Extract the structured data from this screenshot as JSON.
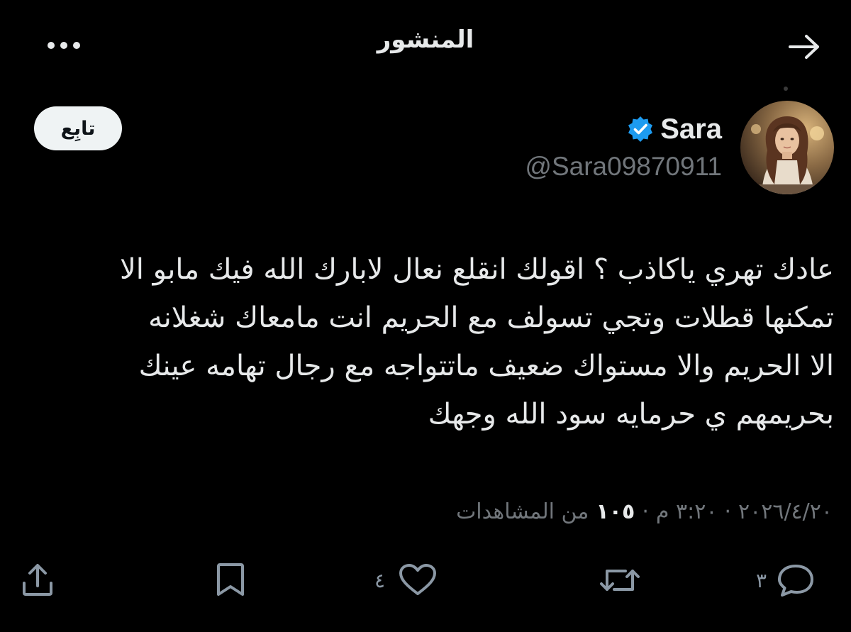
{
  "header": {
    "title": "المنشور",
    "more_icon": "more-dots-icon",
    "back_icon": "arrow-right-icon"
  },
  "author": {
    "display_name": "Sara",
    "handle": "@Sara09870911",
    "verified_icon": "verified-badge-icon",
    "verified_color": "#1d9bf0",
    "follow_label": "تابِع"
  },
  "post": {
    "lines": [
      "عادك تهري ياكاذب ؟ اقولك انقلع نعال لابارك الله فيك مابو الا",
      "تمكنها قطلات وتجي تسولف مع الحريم انت  مامعاك شغلانه",
      "الا الحريم والا مستواك ضعيف ماتتواجه مع رجال تهامه عينك",
      "بحريمهم ي حرمايه سود الله وجهك"
    ]
  },
  "meta": {
    "date": "٢٠٢٦/٤/٢٠",
    "time": "٣:٢٠ م",
    "separator": "·",
    "views_count": "١٠٥",
    "views_label": "من المشاهدات"
  },
  "actions": {
    "reply_count": "٣",
    "like_count": "٤",
    "reply_icon": "reply-bubble-icon",
    "repost_icon": "repost-icon",
    "like_icon": "heart-icon",
    "bookmark_icon": "bookmark-icon",
    "share_icon": "share-icon"
  },
  "colors": {
    "background": "#000000",
    "text_primary": "#e7e9ea",
    "text_secondary": "#71767b",
    "follow_button_bg": "#eff3f4"
  }
}
